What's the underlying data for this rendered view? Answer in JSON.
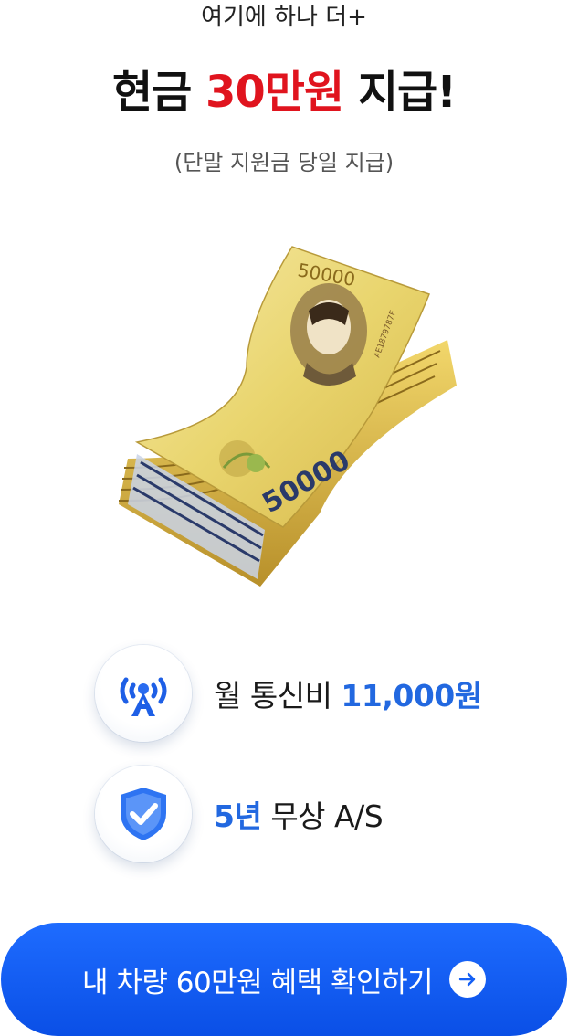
{
  "header": {
    "subtitle": "여기에 하나 더+",
    "headline_pre": "현금 ",
    "headline_highlight": "30만원",
    "headline_post": " 지급!",
    "note": "(단말 지원금 당일 지급)"
  },
  "banknote": {
    "denomination": "50000",
    "serial": "AE1879787F"
  },
  "features": [
    {
      "icon": "signal-tower-icon",
      "text": "월 통신비 ",
      "highlight": "11,000원",
      "highlight_first": false
    },
    {
      "icon": "shield-check-icon",
      "highlight": "5년",
      "text": " 무상 A/S",
      "highlight_first": true
    }
  ],
  "cta": {
    "label": "내 차량 60만원 혜택 확인하기",
    "icon": "arrow-right-icon"
  },
  "colors": {
    "headline_highlight": "#e0141e",
    "feature_highlight": "#2268e0",
    "cta_background": "#1560f5"
  }
}
